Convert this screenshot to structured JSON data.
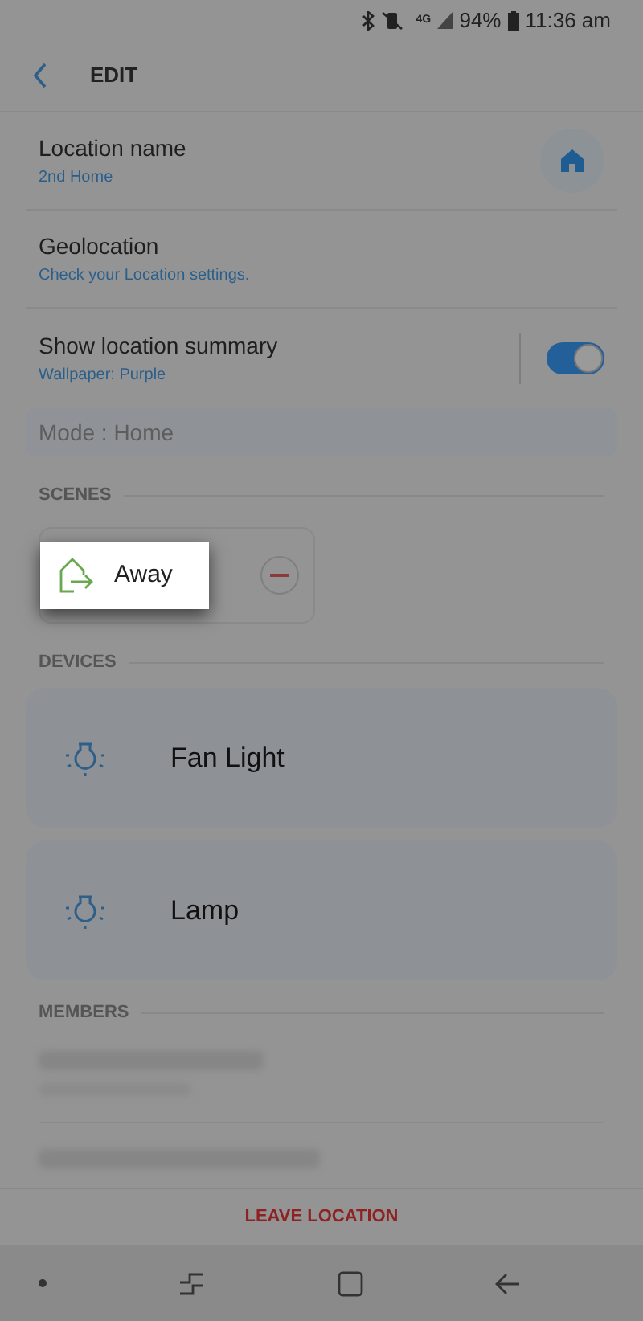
{
  "status_bar": {
    "network": "4G",
    "battery": "94%",
    "time": "11:36 am"
  },
  "header": {
    "title": "EDIT"
  },
  "settings": [
    {
      "kind": "icon",
      "label": "Location name",
      "value": "2nd Home"
    },
    {
      "kind": "plain",
      "label": "Geolocation",
      "value": "Check your Location settings."
    },
    {
      "kind": "toggle",
      "label": "Show location summary",
      "value": "Wallpaper: Purple",
      "on": true
    }
  ],
  "mode_field": {
    "value": "Mode : Home"
  },
  "scenes": {
    "title": "SCENES",
    "items": [
      {
        "name": "Away",
        "highlighted": true
      }
    ]
  },
  "devices": {
    "title": "DEVICES",
    "items": [
      {
        "name": "Fan Light"
      },
      {
        "name": "Lamp"
      }
    ]
  },
  "members": {
    "title": "MEMBERS"
  },
  "leave_button": "LEAVE LOCATION"
}
